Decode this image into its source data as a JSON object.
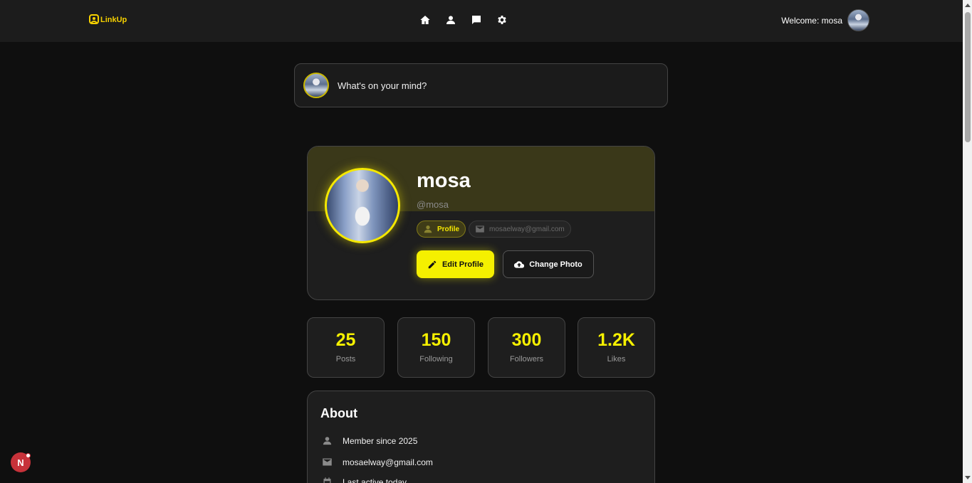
{
  "header": {
    "logo_text": "LinkUp",
    "welcome_text": "Welcome: mosa",
    "nav_icons": [
      "home-icon",
      "user-icon",
      "chat-icon",
      "settings-icon"
    ]
  },
  "composer": {
    "placeholder": "What's on your mind?"
  },
  "profile": {
    "name": "mosa",
    "handle": "@mosa",
    "role_chip": "Profile",
    "email_chip": "mosaelway@gmail.com",
    "edit_button": "Edit Profile",
    "photo_button": "Change Photo"
  },
  "stats": [
    {
      "value": "25",
      "label": "Posts"
    },
    {
      "value": "150",
      "label": "Following"
    },
    {
      "value": "300",
      "label": "Followers"
    },
    {
      "value": "1.2K",
      "label": "Likes"
    }
  ],
  "about": {
    "title": "About",
    "rows": [
      {
        "icon": "user-icon",
        "text": "Member since 2025"
      },
      {
        "icon": "mail-icon",
        "text": "mosaelway@gmail.com"
      },
      {
        "icon": "calendar-icon",
        "text": "Last active today"
      }
    ]
  },
  "fab": {
    "label": "N"
  },
  "colors": {
    "accent": "#f5f000",
    "background": "#0f0f0f",
    "card": "#1e1e1e"
  }
}
